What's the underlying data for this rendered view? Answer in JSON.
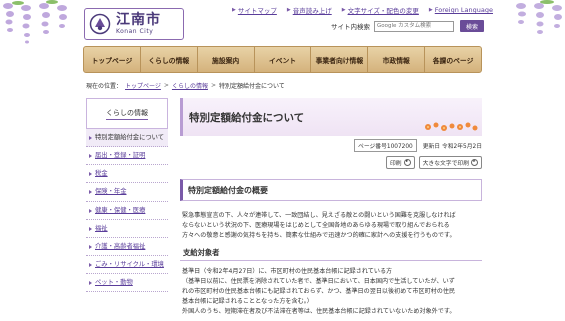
{
  "header": {
    "logo_jp": "江南市",
    "logo_en": "Konan City",
    "top_links": [
      "サイトマップ",
      "音声読み上げ",
      "文字サイズ・配色の変更",
      "Foreign Language"
    ],
    "search_label": "サイト内検索",
    "search_placeholder": "Google カスタム検索",
    "search_button": "検索"
  },
  "nav": {
    "items": [
      "トップページ",
      "くらしの情報",
      "施設案内",
      "イベント",
      "事業者向け情報",
      "市政情報",
      "各課のページ"
    ]
  },
  "breadcrumb": {
    "label": "現在の位置：",
    "items": [
      "トップページ",
      "くらしの情報"
    ],
    "current": "特別定額給付金について",
    "separator": ">"
  },
  "sidebar": {
    "heading": "くらしの情報",
    "current_item": "特別定額給付金について",
    "items": [
      "届出・登録・証明",
      "税金",
      "保険・年金",
      "健康・保健・医療",
      "福祉",
      "介護・高齢者福祉",
      "ごみ・リサイクル・環境",
      "ペット・動物"
    ]
  },
  "main": {
    "title": "特別定額給付金について",
    "page_no": "ページ番号1007200",
    "updated": "更新日 令和2年5月2日",
    "print_label": "印刷",
    "large_print_label": "大きな文字で印刷",
    "section_title": "特別定額給付金の概要",
    "overview_lines": [
      "緊急事態宣言の下、人々が連帯して、一致団結し、見えざる敵との闘いという国難を克服しなければ",
      "ならないという状況の下、医療現場をはじめとして全国各地のあらゆる現場で取り組んでおられる",
      "方々への敬意と感謝の気持ちを持ち、簡素な仕組みで迅速かつ的確に家計への支援を行うものです。"
    ],
    "eligibility_heading": "支給対象者",
    "eligibility_lines": [
      "基準日（令和2年4月27日）に、市区町村の住民基本台帳に記録されている方",
      "（基準日以前に、住民票を消除されていた者で、基準日において、日本国内で生活していたが、いず",
      "れの市区町村の住民基本台帳にも記録されておらず、かつ、基準日の翌日以後初めて市区町村の住民",
      "基本台帳に記録されることとなった方を含む。）",
      "外国人のうち、短期滞在者及び不法滞在者等は、住民基本台帳に記録されていないため対象外です。"
    ]
  },
  "colors": {
    "accent_purple": "#6a4c98",
    "nav_gold": "#d4b27c",
    "link": "#5a3d9a"
  }
}
